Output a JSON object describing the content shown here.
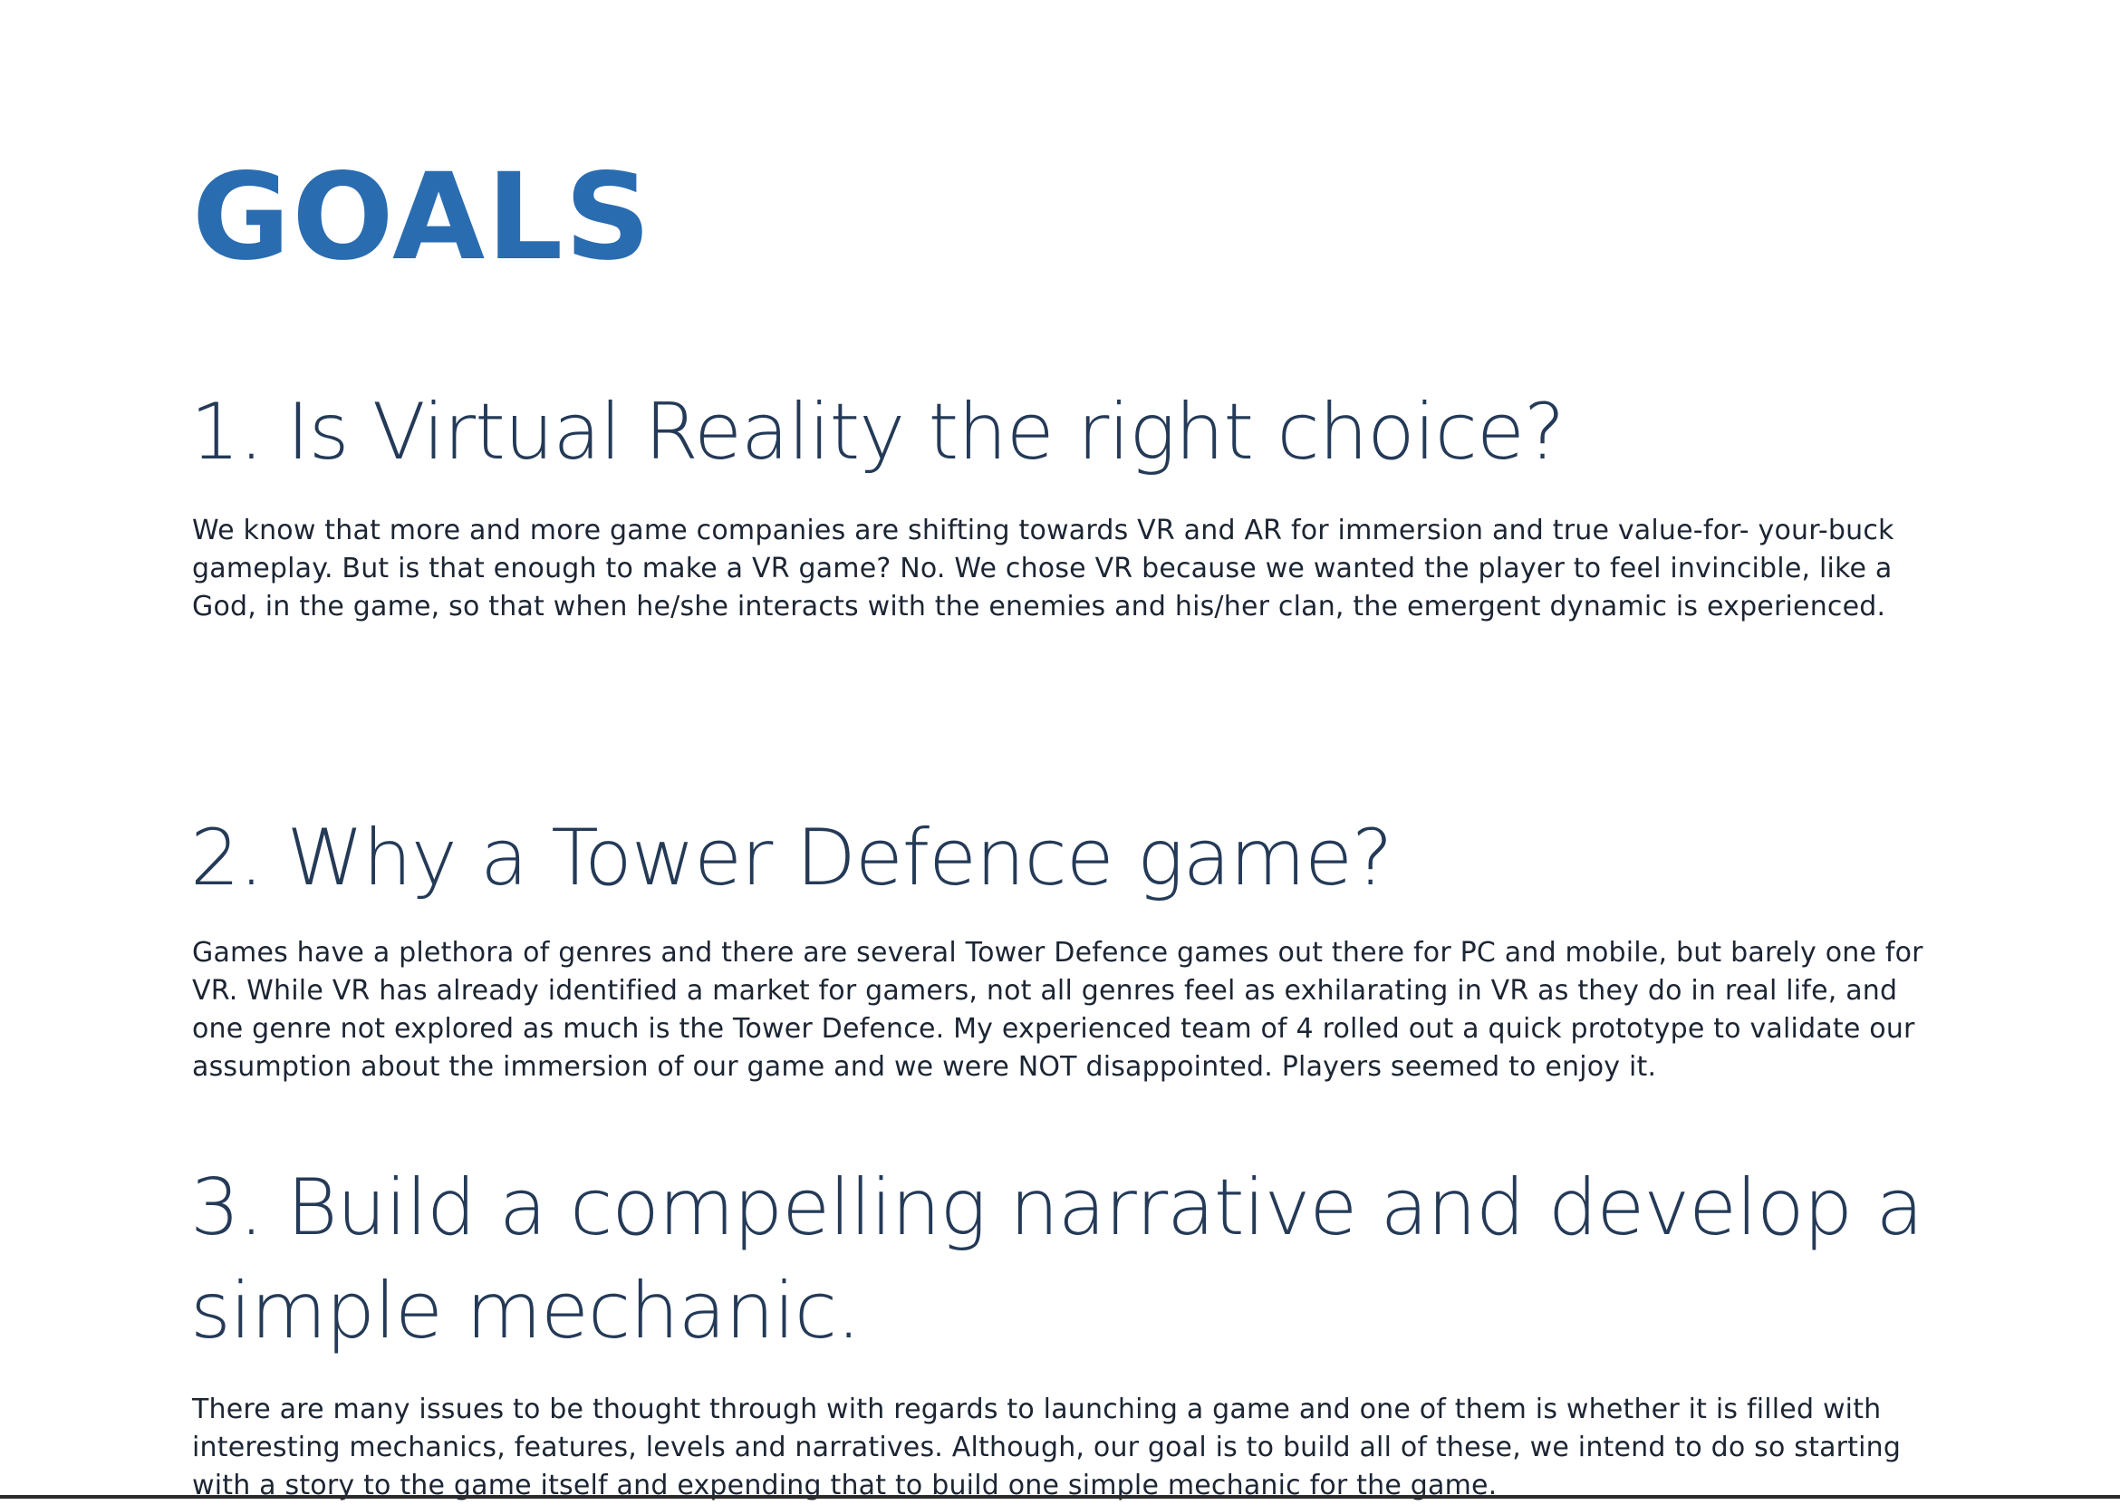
{
  "document": {
    "title": "GOALS",
    "sections": [
      {
        "heading": "1. Is Virtual Reality the right choice?",
        "body": "We know that more and more game companies are shifting towards VR and AR for immersion and true value-for- your-buck gameplay. But is that enough to make a VR game? No. We chose VR because we wanted the player to feel invincible, like a God, in the game, so that when he/she interacts with the enemies and his/her clan, the emergent dynamic is experienced."
      },
      {
        "heading": "2. Why a Tower Defence game?",
        "body": "Games have a plethora of genres and there are several Tower Defence games out there for PC and mobile, but barely one for VR. While VR has already identified a market for gamers, not all genres feel as exhilarating in VR as they do in real life, and one genre not explored as much is the Tower Defence. My experienced team of 4 rolled out a quick prototype to validate our assumption about the immersion of our game and we were NOT disappointed. Players seemed to enjoy it."
      },
      {
        "heading": "3. Build a compelling narrative and develop a simple mechanic.",
        "body": "There are many issues to be thought through with regards to launching a game and one of them is whether it is filled with interesting mechanics, features, levels and narratives. Although, our goal is to build all of these, we intend to do so starting with a story to the game itself and expending that to build one simple mechanic for the game."
      }
    ]
  },
  "colors": {
    "title": "#2a6cb0",
    "heading": "#243a57",
    "body": "#1c2533",
    "background": "#ffffff"
  }
}
